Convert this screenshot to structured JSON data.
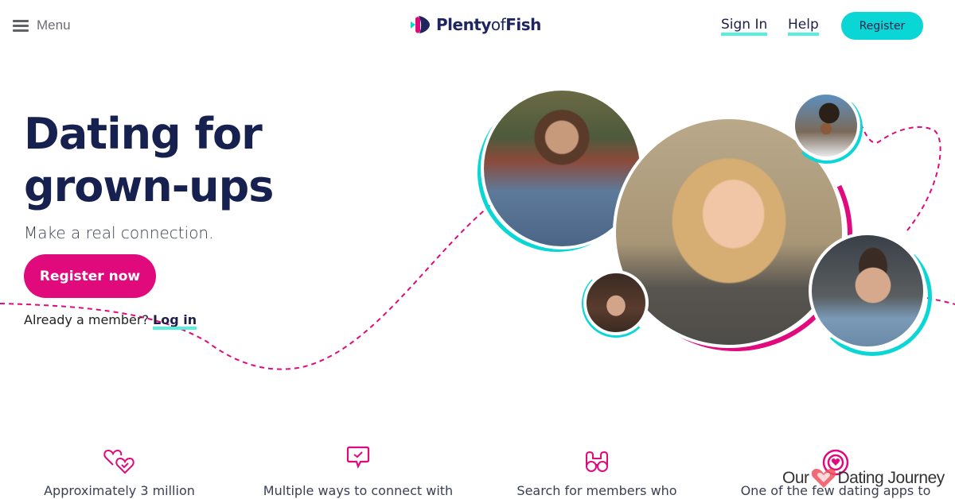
{
  "header": {
    "menu_label": "Menu",
    "logo": {
      "bold": "Plenty",
      "mid": "of",
      "end": "Fish"
    },
    "nav": {
      "sign_in": "Sign In",
      "help": "Help",
      "register": "Register"
    }
  },
  "hero": {
    "title_line1": "Dating for",
    "title_line2": "grown-ups",
    "subtitle": "Make a real connection.",
    "cta": "Register now",
    "already_member": "Already a member?",
    "login": "Log in"
  },
  "features": [
    {
      "icon": "hearts-check-icon",
      "text": "Approximately 3 million"
    },
    {
      "icon": "chat-check-icon",
      "text": "Multiple ways to connect with"
    },
    {
      "icon": "binoculars-icon",
      "text": "Search for members who"
    },
    {
      "icon": "heart-target-icon",
      "text": "One of the few dating apps to"
    }
  ],
  "watermark": {
    "left": "Our",
    "right": "Dating Journey"
  },
  "colors": {
    "accent_teal": "#0ad6d6",
    "highlight": "#54f7df",
    "pink": "#e10a7d",
    "navy": "#16214f"
  }
}
